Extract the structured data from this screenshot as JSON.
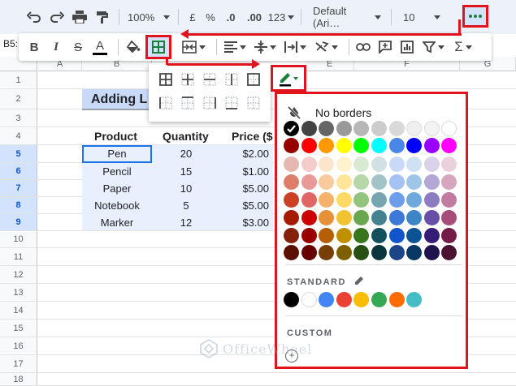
{
  "toolbar": {
    "zoom": "100%",
    "currency": "£",
    "percent": "%",
    "decrease_decimal": ".0",
    "increase_decimal": ".00",
    "more_formats": "123",
    "font": "Default (Ari…",
    "font_size": "10"
  },
  "cell_ref": "B5:",
  "columns": [
    "A",
    "B",
    "E",
    "F",
    "G"
  ],
  "rows": [
    "1",
    "2",
    "3",
    "4",
    "5",
    "6",
    "7",
    "8",
    "9",
    "10",
    "11",
    "12",
    "13",
    "14",
    "15",
    "16",
    "17",
    "18"
  ],
  "sheet": {
    "title": "Adding L",
    "headers": [
      "Product",
      "Quantity",
      "Price ($"
    ],
    "data": [
      [
        "Pen",
        "20",
        "$2.00"
      ],
      [
        "Pencil",
        "15",
        "$1.00"
      ],
      [
        "Paper",
        "10",
        "$5.00"
      ],
      [
        "Notebook",
        "5",
        "$5.00"
      ],
      [
        "Marker",
        "12",
        "$3.00"
      ]
    ]
  },
  "format_bar": {
    "bold": "B",
    "italic": "I",
    "strike": "S",
    "text_color": "A"
  },
  "palette": {
    "no_borders_label": "No borders",
    "standard_label": "STANDARD",
    "custom_label": "CUSTOM",
    "add_custom_symbol": "+",
    "grid_colors": [
      [
        "#000000",
        "#434343",
        "#666666",
        "#999999",
        "#b7b7b7",
        "#cccccc",
        "#d9d9d9",
        "#efefef",
        "#f3f3f3",
        "#ffffff"
      ],
      [
        "#980000",
        "#ff0000",
        "#ff9900",
        "#ffff00",
        "#00ff00",
        "#00ffff",
        "#4a86e8",
        "#0000ff",
        "#9900ff",
        "#ff00ff"
      ],
      [
        "#e6b8af",
        "#f4cccc",
        "#fce5cd",
        "#fff2cc",
        "#d9ead3",
        "#d0e0e3",
        "#c9daf8",
        "#cfe2f3",
        "#d9d2e9",
        "#ead1dc"
      ],
      [
        "#dd7e6b",
        "#ea9999",
        "#f9cb9c",
        "#ffe599",
        "#b6d7a8",
        "#a2c4c9",
        "#a4c2f4",
        "#9fc5e8",
        "#b4a7d6",
        "#d5a6bd"
      ],
      [
        "#cc4125",
        "#e06666",
        "#f6b26b",
        "#ffd966",
        "#93c47d",
        "#76a5af",
        "#6d9eeb",
        "#6fa8dc",
        "#8e7cc3",
        "#c27ba0"
      ],
      [
        "#a61c00",
        "#cc0000",
        "#e69138",
        "#f1c232",
        "#6aa84f",
        "#45818e",
        "#3c78d8",
        "#3d85c6",
        "#674ea7",
        "#a64d79"
      ],
      [
        "#85200c",
        "#990000",
        "#b45f06",
        "#bf9000",
        "#38761d",
        "#134f5c",
        "#1155cc",
        "#0b5394",
        "#351c75",
        "#741b47"
      ],
      [
        "#5b0f00",
        "#660000",
        "#783f04",
        "#7f6000",
        "#274e13",
        "#0c343d",
        "#1c4587",
        "#073763",
        "#20124d",
        "#4c1130"
      ]
    ],
    "standard_colors": [
      "#000000",
      "#ffffff",
      "#4285f4",
      "#ea4335",
      "#fbbc04",
      "#34a853",
      "#ff6d01",
      "#46bdc6"
    ],
    "selected_color": "#000000"
  },
  "watermark": "OfficeWheel",
  "accent": "#e0141e"
}
